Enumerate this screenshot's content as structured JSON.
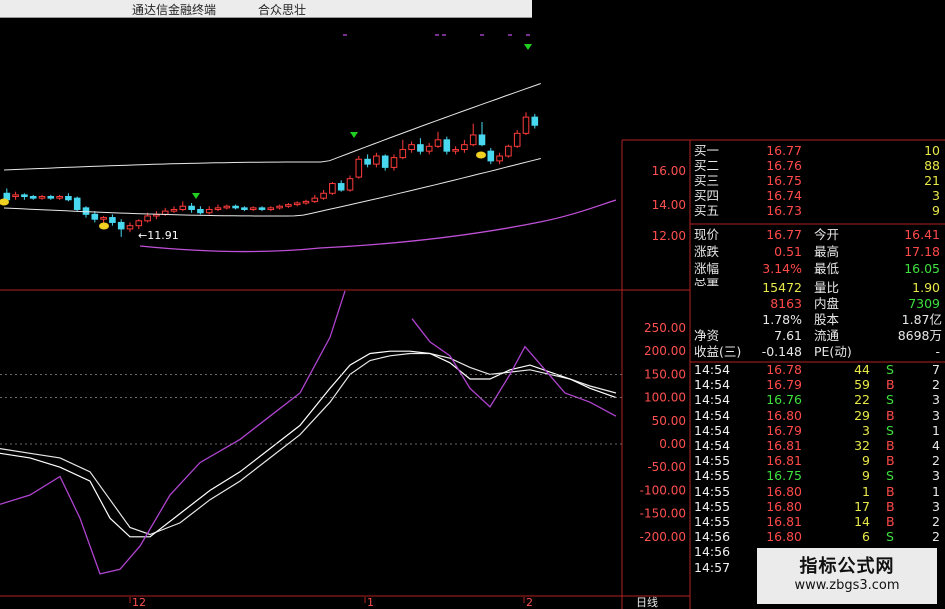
{
  "window": {
    "title": "通达信金融终端",
    "subtitle": "合众思壮"
  },
  "price_axis": {
    "ticks": [
      "16.00",
      "14.00",
      "12.00"
    ]
  },
  "annotations": {
    "low_price": "11.91"
  },
  "indicator_axis": {
    "ticks": [
      "250.00",
      "200.00",
      "150.00",
      "100.00",
      "50.00",
      "0.00",
      "-50.00",
      "-100.00",
      "-150.00",
      "-200.00"
    ]
  },
  "date_axis": {
    "labels": [
      "12",
      "1",
      "2"
    ],
    "period": "日线"
  },
  "order_book": [
    {
      "label": "买一",
      "price": "16.77",
      "volume": "10"
    },
    {
      "label": "买二",
      "price": "16.76",
      "volume": "88"
    },
    {
      "label": "买三",
      "price": "16.75",
      "volume": "21"
    },
    {
      "label": "买四",
      "price": "16.74",
      "volume": "3"
    },
    {
      "label": "买五",
      "price": "16.73",
      "volume": "9"
    }
  ],
  "quote": {
    "now_label": "现价",
    "now": "16.77",
    "open_label": "今开",
    "open": "16.41",
    "chg_label": "涨跌",
    "chg": "0.51",
    "high_label": "最高",
    "high": "17.18",
    "pct_label": "涨幅",
    "pct": "3.14%",
    "low_label": "最低",
    "low": "16.05",
    "vol_label": "总量",
    "vol": "15472",
    "ratio_label": "量比",
    "ratio": "1.90",
    "outer_val": "8163",
    "inner_label": "内盘",
    "inner": "7309",
    "turnover": "1.78%",
    "capital_label": "股本",
    "capital": "1.87亿",
    "nav_label": "净资",
    "nav": "7.61",
    "float_label": "流通",
    "float": "8698万",
    "eps_label": "收益(三)",
    "eps": "-0.148",
    "pe_label": "PE(动)",
    "pe": "-"
  },
  "ticks": [
    {
      "time": "14:54",
      "price": "16.78",
      "vol": "44",
      "side": "S",
      "n": "7"
    },
    {
      "time": "14:54",
      "price": "16.79",
      "vol": "59",
      "side": "B",
      "n": "2"
    },
    {
      "time": "14:54",
      "price": "16.76",
      "vol": "22",
      "side": "S",
      "n": "3"
    },
    {
      "time": "14:54",
      "price": "16.80",
      "vol": "29",
      "side": "B",
      "n": "3"
    },
    {
      "time": "14:54",
      "price": "16.79",
      "vol": "3",
      "side": "S",
      "n": "1"
    },
    {
      "time": "14:54",
      "price": "16.81",
      "vol": "32",
      "side": "B",
      "n": "4"
    },
    {
      "time": "14:55",
      "price": "16.81",
      "vol": "9",
      "side": "B",
      "n": "2"
    },
    {
      "time": "14:55",
      "price": "16.75",
      "vol": "9",
      "side": "S",
      "n": "3"
    },
    {
      "time": "14:55",
      "price": "16.80",
      "vol": "1",
      "side": "B",
      "n": "1"
    },
    {
      "time": "14:55",
      "price": "16.80",
      "vol": "17",
      "side": "B",
      "n": "3"
    },
    {
      "time": "14:55",
      "price": "16.81",
      "vol": "14",
      "side": "B",
      "n": "2"
    },
    {
      "time": "14:56",
      "price": "16.80",
      "vol": "6",
      "side": "S",
      "n": "2"
    }
  ],
  "extra_times": [
    "14:56",
    "14:57"
  ],
  "candles": [
    {
      "o": 14.6,
      "c": 14.2,
      "h": 14.9,
      "l": 14.0
    },
    {
      "o": 14.4,
      "c": 14.5,
      "h": 14.7,
      "l": 14.2
    },
    {
      "o": 14.5,
      "c": 14.4,
      "h": 14.6,
      "l": 14.2
    },
    {
      "o": 14.4,
      "c": 14.3,
      "h": 14.5,
      "l": 14.2
    },
    {
      "o": 14.3,
      "c": 14.4,
      "h": 14.5,
      "l": 14.2
    },
    {
      "o": 14.4,
      "c": 14.3,
      "h": 14.5,
      "l": 14.2
    },
    {
      "o": 14.3,
      "c": 14.4,
      "h": 14.5,
      "l": 14.2
    },
    {
      "o": 14.4,
      "c": 14.2,
      "h": 14.6,
      "l": 14.1
    },
    {
      "o": 14.3,
      "c": 13.6,
      "h": 14.4,
      "l": 13.5
    },
    {
      "o": 13.7,
      "c": 13.3,
      "h": 13.8,
      "l": 13.1
    },
    {
      "o": 13.3,
      "c": 13.0,
      "h": 13.5,
      "l": 12.8
    },
    {
      "o": 13.0,
      "c": 13.1,
      "h": 13.2,
      "l": 12.7
    },
    {
      "o": 13.1,
      "c": 12.8,
      "h": 13.3,
      "l": 12.6
    },
    {
      "o": 12.8,
      "c": 12.4,
      "h": 13.0,
      "l": 11.91
    },
    {
      "o": 12.4,
      "c": 12.6,
      "h": 12.8,
      "l": 12.2
    },
    {
      "o": 12.6,
      "c": 12.9,
      "h": 13.0,
      "l": 12.4
    },
    {
      "o": 12.9,
      "c": 13.2,
      "h": 13.4,
      "l": 12.8
    },
    {
      "o": 13.2,
      "c": 13.3,
      "h": 13.5,
      "l": 13.0
    },
    {
      "o": 13.3,
      "c": 13.5,
      "h": 13.7,
      "l": 13.2
    },
    {
      "o": 13.5,
      "c": 13.6,
      "h": 13.8,
      "l": 13.4
    },
    {
      "o": 13.6,
      "c": 13.8,
      "h": 14.1,
      "l": 13.5
    },
    {
      "o": 13.8,
      "c": 13.6,
      "h": 14.0,
      "l": 13.4
    },
    {
      "o": 13.6,
      "c": 13.4,
      "h": 13.8,
      "l": 13.3
    },
    {
      "o": 13.4,
      "c": 13.6,
      "h": 13.8,
      "l": 13.3
    },
    {
      "o": 13.6,
      "c": 13.7,
      "h": 13.9,
      "l": 13.5
    },
    {
      "o": 13.7,
      "c": 13.8,
      "h": 13.9,
      "l": 13.6
    },
    {
      "o": 13.8,
      "c": 13.7,
      "h": 13.9,
      "l": 13.6
    },
    {
      "o": 13.7,
      "c": 13.6,
      "h": 13.8,
      "l": 13.5
    },
    {
      "o": 13.6,
      "c": 13.7,
      "h": 13.8,
      "l": 13.5
    },
    {
      "o": 13.7,
      "c": 13.6,
      "h": 13.8,
      "l": 13.5
    },
    {
      "o": 13.6,
      "c": 13.7,
      "h": 13.8,
      "l": 13.5
    },
    {
      "o": 13.7,
      "c": 13.8,
      "h": 13.9,
      "l": 13.6
    },
    {
      "o": 13.8,
      "c": 13.9,
      "h": 14.0,
      "l": 13.7
    },
    {
      "o": 13.9,
      "c": 14.0,
      "h": 14.1,
      "l": 13.8
    },
    {
      "o": 14.0,
      "c": 14.1,
      "h": 14.2,
      "l": 13.9
    },
    {
      "o": 14.1,
      "c": 14.3,
      "h": 14.5,
      "l": 14.0
    },
    {
      "o": 14.3,
      "c": 14.6,
      "h": 14.8,
      "l": 14.2
    },
    {
      "o": 14.6,
      "c": 15.2,
      "h": 15.3,
      "l": 14.5
    },
    {
      "o": 15.2,
      "c": 14.8,
      "h": 15.4,
      "l": 14.7
    },
    {
      "o": 14.8,
      "c": 15.5,
      "h": 15.7,
      "l": 14.7
    },
    {
      "o": 15.6,
      "c": 16.7,
      "h": 16.9,
      "l": 15.5
    },
    {
      "o": 16.7,
      "c": 16.4,
      "h": 17.0,
      "l": 16.2
    },
    {
      "o": 16.4,
      "c": 16.9,
      "h": 17.1,
      "l": 16.2
    },
    {
      "o": 16.9,
      "c": 16.2,
      "h": 17.0,
      "l": 16.0
    },
    {
      "o": 16.2,
      "c": 16.8,
      "h": 17.0,
      "l": 16.0
    },
    {
      "o": 16.8,
      "c": 17.3,
      "h": 17.9,
      "l": 16.7
    },
    {
      "o": 17.3,
      "c": 17.6,
      "h": 17.8,
      "l": 17.1
    },
    {
      "o": 17.6,
      "c": 17.2,
      "h": 18.0,
      "l": 17.0
    },
    {
      "o": 17.2,
      "c": 17.5,
      "h": 17.7,
      "l": 17.0
    },
    {
      "o": 17.5,
      "c": 17.9,
      "h": 18.4,
      "l": 17.4
    },
    {
      "o": 17.9,
      "c": 17.2,
      "h": 18.1,
      "l": 17.0
    },
    {
      "o": 17.2,
      "c": 17.3,
      "h": 17.5,
      "l": 17.0
    },
    {
      "o": 17.3,
      "c": 17.6,
      "h": 17.9,
      "l": 17.1
    },
    {
      "o": 17.6,
      "c": 18.2,
      "h": 18.9,
      "l": 17.5
    },
    {
      "o": 18.2,
      "c": 17.6,
      "h": 19.0,
      "l": 17.5
    },
    {
      "o": 17.2,
      "c": 16.6,
      "h": 17.4,
      "l": 16.4
    },
    {
      "o": 16.6,
      "c": 16.9,
      "h": 17.1,
      "l": 16.4
    },
    {
      "o": 16.9,
      "c": 17.5,
      "h": 17.6,
      "l": 16.8
    },
    {
      "o": 17.5,
      "c": 18.3,
      "h": 18.5,
      "l": 17.4
    },
    {
      "o": 18.3,
      "c": 19.3,
      "h": 19.6,
      "l": 18.2
    },
    {
      "o": 19.3,
      "c": 18.8,
      "h": 19.5,
      "l": 18.6
    }
  ],
  "colors": {
    "up": "#ff3b3b",
    "down": "#48d8f0",
    "upper_band": "#e8e8e8",
    "lower_band": "#c050d8",
    "kline": "#ffffff",
    "dline": "#e8e8e8",
    "jline": "#b044d0",
    "axis": "#b02020",
    "signal_up": "#20d020",
    "signal_dn": "#f0d020"
  }
}
